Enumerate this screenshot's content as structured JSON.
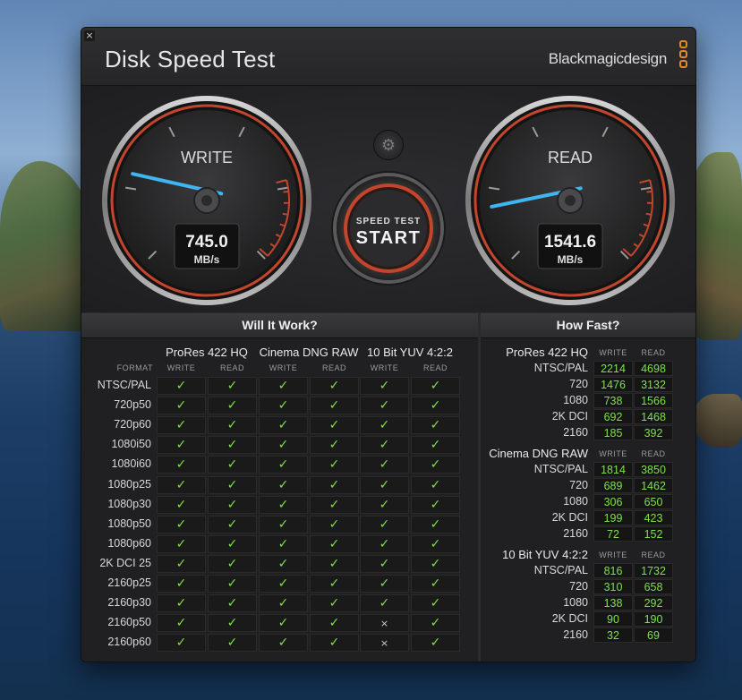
{
  "app": {
    "title": "Disk Speed Test",
    "brand": "Blackmagicdesign",
    "close_icon": "close-icon",
    "accent_color": "#c4452d",
    "ok_color": "#7fe04a"
  },
  "gauges": {
    "write": {
      "label": "WRITE",
      "value": "745.0",
      "unit": "MB/s",
      "needle_fraction": 0.24
    },
    "read": {
      "label": "READ",
      "value": "1541.6",
      "unit": "MB/s",
      "needle_fraction": 0.15
    }
  },
  "start_button": {
    "small": "SPEED TEST",
    "big": "START",
    "settings_icon": "gear-icon"
  },
  "will_it_work": {
    "title": "Will It Work?",
    "format_label": "FORMAT",
    "groups": [
      {
        "name": "ProRes 422 HQ",
        "cols": [
          "WRITE",
          "READ"
        ]
      },
      {
        "name": "Cinema DNG RAW",
        "cols": [
          "WRITE",
          "READ"
        ]
      },
      {
        "name": "10 Bit YUV 4:2:2",
        "cols": [
          "WRITE",
          "READ"
        ]
      }
    ],
    "check_glyph": "✓",
    "cross_glyph": "×",
    "rows": [
      {
        "format": "NTSC/PAL",
        "cells": [
          1,
          1,
          1,
          1,
          1,
          1
        ]
      },
      {
        "format": "720p50",
        "cells": [
          1,
          1,
          1,
          1,
          1,
          1
        ]
      },
      {
        "format": "720p60",
        "cells": [
          1,
          1,
          1,
          1,
          1,
          1
        ]
      },
      {
        "format": "1080i50",
        "cells": [
          1,
          1,
          1,
          1,
          1,
          1
        ]
      },
      {
        "format": "1080i60",
        "cells": [
          1,
          1,
          1,
          1,
          1,
          1
        ]
      },
      {
        "format": "1080p25",
        "cells": [
          1,
          1,
          1,
          1,
          1,
          1
        ]
      },
      {
        "format": "1080p30",
        "cells": [
          1,
          1,
          1,
          1,
          1,
          1
        ]
      },
      {
        "format": "1080p50",
        "cells": [
          1,
          1,
          1,
          1,
          1,
          1
        ]
      },
      {
        "format": "1080p60",
        "cells": [
          1,
          1,
          1,
          1,
          1,
          1
        ]
      },
      {
        "format": "2K DCI 25",
        "cells": [
          1,
          1,
          1,
          1,
          1,
          1
        ]
      },
      {
        "format": "2160p25",
        "cells": [
          1,
          1,
          1,
          1,
          1,
          1
        ]
      },
      {
        "format": "2160p30",
        "cells": [
          1,
          1,
          1,
          1,
          1,
          1
        ]
      },
      {
        "format": "2160p50",
        "cells": [
          1,
          1,
          1,
          1,
          0,
          1
        ]
      },
      {
        "format": "2160p60",
        "cells": [
          1,
          1,
          1,
          1,
          0,
          1
        ]
      }
    ]
  },
  "how_fast": {
    "title": "How Fast?",
    "col_write": "WRITE",
    "col_read": "READ",
    "sections": [
      {
        "name": "ProRes 422 HQ",
        "rows": [
          {
            "format": "NTSC/PAL",
            "write": "2214",
            "read": "4698"
          },
          {
            "format": "720",
            "write": "1476",
            "read": "3132"
          },
          {
            "format": "1080",
            "write": "738",
            "read": "1566"
          },
          {
            "format": "2K DCI",
            "write": "692",
            "read": "1468"
          },
          {
            "format": "2160",
            "write": "185",
            "read": "392"
          }
        ]
      },
      {
        "name": "Cinema DNG RAW",
        "rows": [
          {
            "format": "NTSC/PAL",
            "write": "1814",
            "read": "3850"
          },
          {
            "format": "720",
            "write": "689",
            "read": "1462"
          },
          {
            "format": "1080",
            "write": "306",
            "read": "650"
          },
          {
            "format": "2K DCI",
            "write": "199",
            "read": "423"
          },
          {
            "format": "2160",
            "write": "72",
            "read": "152"
          }
        ]
      },
      {
        "name": "10 Bit YUV 4:2:2",
        "rows": [
          {
            "format": "NTSC/PAL",
            "write": "816",
            "read": "1732"
          },
          {
            "format": "720",
            "write": "310",
            "read": "658"
          },
          {
            "format": "1080",
            "write": "138",
            "read": "292"
          },
          {
            "format": "2K DCI",
            "write": "90",
            "read": "190"
          },
          {
            "format": "2160",
            "write": "32",
            "read": "69"
          }
        ]
      }
    ]
  }
}
